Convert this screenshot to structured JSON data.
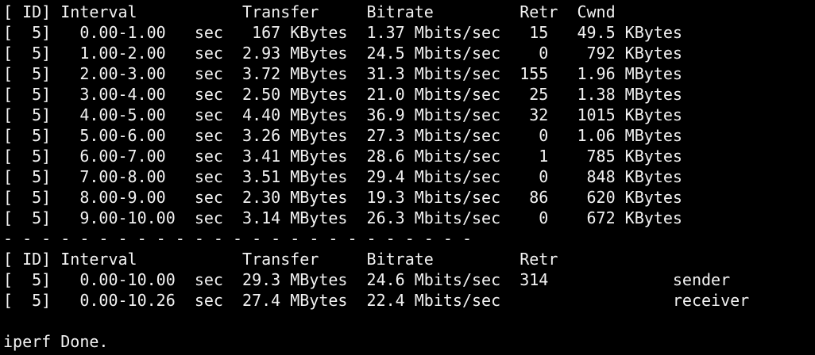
{
  "terminal": {
    "lines": [
      "[ ID] Interval           Transfer     Bitrate         Retr  Cwnd",
      "[  5]   0.00-1.00   sec   167 KBytes  1.37 Mbits/sec   15   49.5 KBytes",
      "[  5]   1.00-2.00   sec  2.93 MBytes  24.5 Mbits/sec    0    792 KBytes",
      "[  5]   2.00-3.00   sec  3.72 MBytes  31.3 Mbits/sec  155   1.96 MBytes",
      "[  5]   3.00-4.00   sec  2.50 MBytes  21.0 Mbits/sec   25   1.38 MBytes",
      "[  5]   4.00-5.00   sec  4.40 MBytes  36.9 Mbits/sec   32   1015 KBytes",
      "[  5]   5.00-6.00   sec  3.26 MBytes  27.3 Mbits/sec    0   1.06 MBytes",
      "[  5]   6.00-7.00   sec  3.41 MBytes  28.6 Mbits/sec    1    785 KBytes",
      "[  5]   7.00-8.00   sec  3.51 MBytes  29.4 Mbits/sec    0    848 KBytes",
      "[  5]   8.00-9.00   sec  2.30 MBytes  19.3 Mbits/sec   86    620 KBytes",
      "[  5]   9.00-10.00  sec  3.14 MBytes  26.3 Mbits/sec    0    672 KBytes",
      "- - - - - - - - - - - - - - - - - - - - - - - - -",
      "[ ID] Interval           Transfer     Bitrate         Retr",
      "[  5]   0.00-10.00  sec  29.3 MBytes  24.6 Mbits/sec  314             sender",
      "[  5]   0.00-10.26  sec  27.4 MBytes  22.4 Mbits/sec                  receiver",
      "",
      "iperf Done."
    ]
  }
}
